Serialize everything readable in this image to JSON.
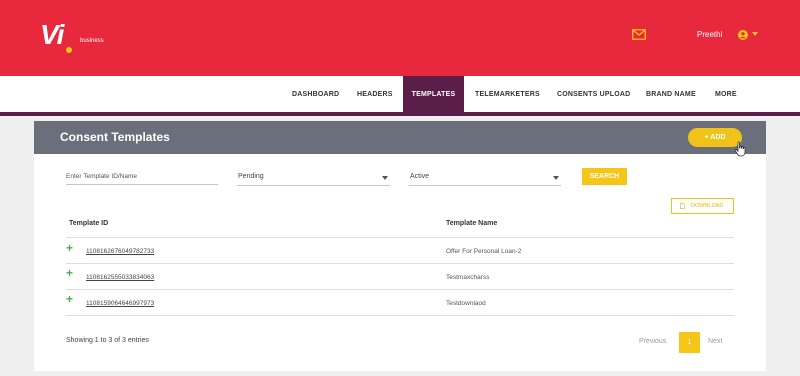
{
  "brand": {
    "logo_text": "Vi",
    "logo_sub": "business",
    "primary_color": "#e8283c",
    "accent_color": "#f5c518",
    "nav_color": "#5b1e4a"
  },
  "header": {
    "user_name": "Preethi",
    "icons": [
      "mail-icon",
      "user-avatar-icon",
      "caret-down-icon"
    ]
  },
  "nav": {
    "items": [
      {
        "label": "DASHBOARD",
        "active": false
      },
      {
        "label": "HEADERS",
        "active": false
      },
      {
        "label": "TEMPLATES",
        "active": true
      },
      {
        "label": "TELEMARKETERS",
        "active": false
      },
      {
        "label": "CONSENTS UPLOAD",
        "active": false
      },
      {
        "label": "BRAND NAME",
        "active": false
      },
      {
        "label": "MORE",
        "active": false
      }
    ]
  },
  "panel": {
    "title": "Consent Templates",
    "add_label": "+ ADD"
  },
  "filters": {
    "search_placeholder": "Enter Template ID/Name",
    "status_value": "Pending",
    "state_value": "Active",
    "search_label": "SEARCH",
    "download_label": "DOWNLOAD"
  },
  "table": {
    "columns": [
      "Template ID",
      "Template Name"
    ],
    "rows": [
      {
        "id": "1108162676049782733",
        "name": "Offer For Personal Loan-2"
      },
      {
        "id": "1108162555033834063",
        "name": "Testmaxcharss"
      },
      {
        "id": "1108159064646997973",
        "name": "Testdownlaod"
      }
    ]
  },
  "pagination": {
    "summary": "Showing 1 to 3 of 3 entries",
    "prev_label": "Previous",
    "current_page": "1",
    "next_label": "Next"
  }
}
